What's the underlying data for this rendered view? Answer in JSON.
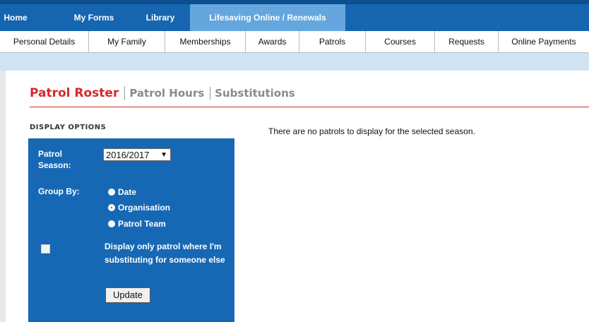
{
  "topnav": {
    "items": [
      {
        "label": "Home"
      },
      {
        "label": "My Forms"
      },
      {
        "label": "Library"
      },
      {
        "label": "Lifesaving Online / Renewals"
      }
    ],
    "active_index": 3
  },
  "subnav": {
    "items": [
      {
        "label": "Personal Details"
      },
      {
        "label": "My Family"
      },
      {
        "label": "Memberships"
      },
      {
        "label": "Awards"
      },
      {
        "label": "Patrols"
      },
      {
        "label": "Courses"
      },
      {
        "label": "Requests"
      },
      {
        "label": "Online Payments"
      }
    ]
  },
  "tabs": [
    {
      "label": "Patrol Roster"
    },
    {
      "label": "Patrol Hours"
    },
    {
      "label": "Substitutions"
    }
  ],
  "display_options": {
    "title": "DISPLAY OPTIONS",
    "season_label_line1": "Patrol",
    "season_label_line2": "Season:",
    "season_value": "2016/2017",
    "group_by_label": "Group By:",
    "group_options": [
      "Date",
      "Organisation",
      "Patrol Team"
    ],
    "group_selected": "Organisation",
    "checkbox_label": "Display only patrol where I'm substituting for someone else",
    "checkbox_checked": false,
    "update_label": "Update"
  },
  "message": "There are no patrols to display for the selected season.",
  "colors": {
    "nav_blue": "#1565b0",
    "nav_active": "#64a6dd",
    "accent_red": "#d62828",
    "panel_blue": "#1668b4"
  }
}
